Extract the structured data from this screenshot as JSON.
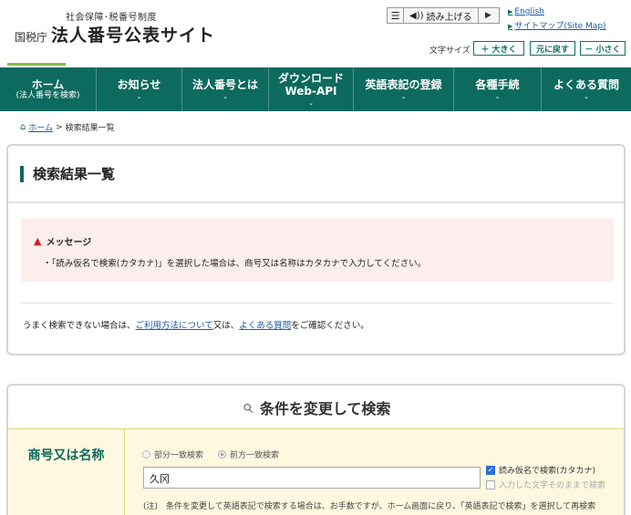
{
  "header": {
    "logo_sub": "社会保障･税番号制度",
    "logo_agency": "国税庁",
    "logo_title": "法人番号公表サイト",
    "tts_menu_icon": "☰",
    "tts_read": "読み上げる",
    "tts_play": "▶",
    "link_english": "English",
    "link_sitemap": "サイトマップ(Site Map)",
    "font_size_label": "文字サイズ",
    "font_larger": "大きく",
    "font_reset": "元に戻す",
    "font_smaller": "小さく",
    "accent_color": "#0d6a5e"
  },
  "nav": {
    "items": [
      {
        "label": "ホーム",
        "sub": "(法人番号を検索)"
      },
      {
        "label": "お知らせ"
      },
      {
        "label": "法人番号とは"
      },
      {
        "label": "ダウンロード\nWeb-API"
      },
      {
        "label": "英語表記の登録"
      },
      {
        "label": "各種手続"
      },
      {
        "label": "よくある質問"
      }
    ]
  },
  "breadcrumb": {
    "home": "ホーム",
    "separator": ">",
    "current": "検索結果一覧"
  },
  "result": {
    "title": "検索結果一覧",
    "message_heading": "メッセージ",
    "message_text": "・「読み仮名で検索(カタカナ)」を選択した場合は、商号又は名称はカタカナで入力してください。",
    "help_prefix": "うまく検索できない場合は、",
    "help_link1": "ご利用方法について",
    "help_mid": "又は、",
    "help_link2": "よくある質問",
    "help_suffix": "をご確認ください。"
  },
  "search": {
    "title": "条件を変更して検索",
    "field_label": "商号又は名称",
    "radio_partial": "部分一致検索",
    "radio_prefix": "前方一致検索",
    "radio_selected": "前方一致検索",
    "input_value": "久冈",
    "checkbox_kana": "読み仮名で検索(カタカナ)",
    "checkbox_kana_checked": true,
    "checkbox_asis": "入力した文字そのままで検索",
    "checkbox_asis_checked": false,
    "note": "(注)　条件を変更して英語表記で検索する場合は、お手数ですが、ホーム画面に戻り、「英語表記で検索」を選択して再検索"
  }
}
